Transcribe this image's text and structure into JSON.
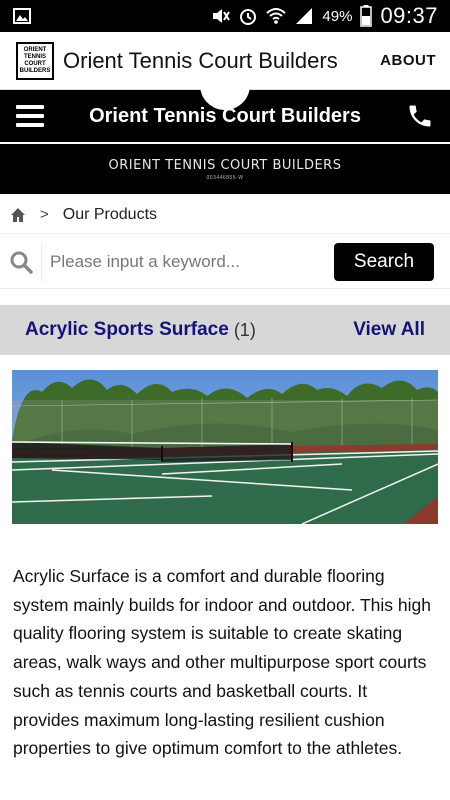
{
  "status_bar": {
    "battery": "49%",
    "time": "09:37",
    "icons": [
      "image-icon",
      "mute-icon",
      "alarm-icon",
      "wifi-icon",
      "signal-icon",
      "battery-icon"
    ]
  },
  "app_bar": {
    "logo_lines": [
      "ORIENT",
      "TENNIS",
      "COURT",
      "BUILDERS"
    ],
    "title": "Orient Tennis Court Builders",
    "about_label": "ABOUT"
  },
  "nav_header": {
    "title": "Orient Tennis Court Builders",
    "icons": [
      "menu-icon",
      "phone-icon"
    ]
  },
  "banner": {
    "title": "ORIENT TENNIS COURT BUILDERS",
    "subtitle": "003446855-W"
  },
  "breadcrumb": {
    "separator": ">",
    "current": "Our Products"
  },
  "search": {
    "placeholder": "Please input a keyword...",
    "value": "",
    "button_label": "Search"
  },
  "category": {
    "name": "Acrylic Sports Surface",
    "count": "(1)",
    "view_all_label": "View All"
  },
  "product": {
    "description": "Acrylic Surface is a comfort and durable flooring system mainly builds for indoor and outdoor. This high quality flooring system is suitable to create skating areas, walk ways and other multipurpose sport courts such as tennis courts and basketball courts. It provides maximum long-lasting resilient cushion properties to give optimum comfort to the athletes."
  },
  "colors": {
    "accent_link": "#141478",
    "court_green": "#2f6b4a",
    "court_red": "#8c3a2c",
    "category_bg": "#d7d7d7"
  }
}
